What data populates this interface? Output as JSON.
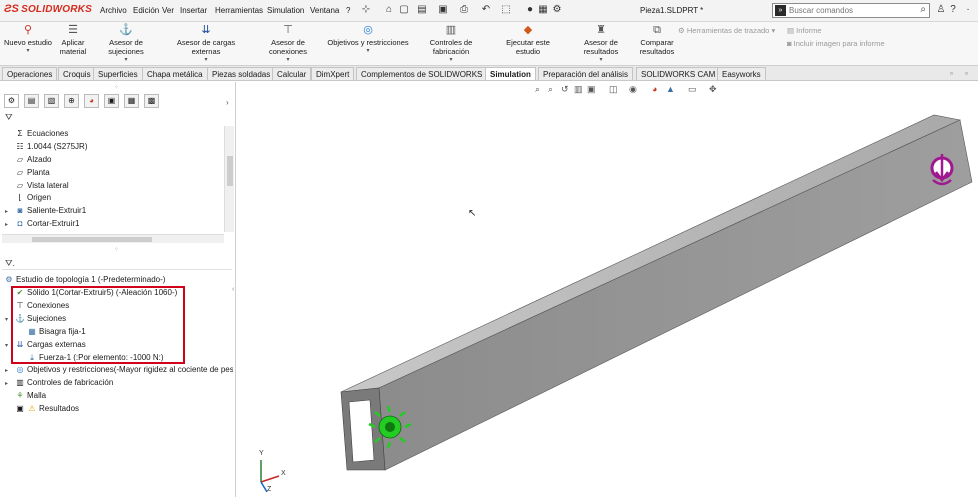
{
  "app": {
    "logo": "SOLIDWORKS",
    "document_title": "Pieza1.SLDPRT *"
  },
  "menu": [
    "Archivo",
    "Edición",
    "Ver",
    "Insertar",
    "Herramientas",
    "Simulation",
    "Ventana",
    "?"
  ],
  "search": {
    "placeholder": "Buscar comandos"
  },
  "ribbon": {
    "buttons": [
      {
        "label": "Nuevo estudio",
        "icon": "new-study-icon"
      },
      {
        "label": "Aplicar material",
        "icon": "apply-material-icon"
      },
      {
        "label": "Asesor de sujeciones",
        "icon": "fixture-advisor-icon"
      },
      {
        "label": "Asesor de cargas externas",
        "icon": "external-loads-icon"
      },
      {
        "label": "Asesor de conexiones",
        "icon": "connections-icon"
      },
      {
        "label": "Objetivos y restricciones",
        "icon": "goals-icon"
      },
      {
        "label": "Controles de fabricación",
        "icon": "manufacturing-icon"
      },
      {
        "label": "Ejecutar este estudio",
        "icon": "run-study-icon"
      },
      {
        "label": "Asesor de resultados",
        "icon": "results-advisor-icon"
      },
      {
        "label": "Comparar resultados",
        "icon": "compare-results-icon"
      },
      {
        "label": "Herramientas de trazado",
        "icon": "plot-tools-icon"
      }
    ],
    "report": "Informe",
    "include_image": "Incluir imagen para informe"
  },
  "tabs": [
    {
      "label": "Operaciones",
      "active": false
    },
    {
      "label": "Croquis",
      "active": false
    },
    {
      "label": "Superficies",
      "active": false
    },
    {
      "label": "Chapa metálica",
      "active": false
    },
    {
      "label": "Piezas soldadas",
      "active": false
    },
    {
      "label": "Calcular",
      "active": false
    },
    {
      "label": "DimXpert",
      "active": false
    },
    {
      "label": "Complementos de SOLIDWORKS",
      "active": false
    },
    {
      "label": "Simulation",
      "active": true
    },
    {
      "label": "Preparación del análisis",
      "active": false
    },
    {
      "label": "SOLIDWORKS CAM",
      "active": false
    },
    {
      "label": "Easyworks",
      "active": false
    }
  ],
  "feature_tree": [
    {
      "label": "Ecuaciones",
      "icon": "equations-icon"
    },
    {
      "label": "1.0044 (S275JR)",
      "icon": "material-icon"
    },
    {
      "label": "Alzado",
      "icon": "plane-icon"
    },
    {
      "label": "Planta",
      "icon": "plane-icon"
    },
    {
      "label": "Vista lateral",
      "icon": "plane-icon"
    },
    {
      "label": "Origen",
      "icon": "origin-icon"
    },
    {
      "label": "Saliente-Extruir1",
      "icon": "extrude-icon"
    },
    {
      "label": "Cortar-Extruir1",
      "icon": "cut-extrude-icon"
    }
  ],
  "study_tree": {
    "study": "Estudio de topología 1 (-Predeterminado-)",
    "items": [
      {
        "label": "Sólido 1(Cortar-Extruir5) (-Aleación 1060-)",
        "icon": "solid-body-icon"
      },
      {
        "label": "Conexiones",
        "icon": "connections-icon"
      },
      {
        "label": "Sujeciones",
        "icon": "fixtures-icon"
      },
      {
        "label": "Bisagra fija-1",
        "icon": "fixed-hinge-icon"
      },
      {
        "label": "Cargas externas",
        "icon": "external-loads-icon"
      },
      {
        "label": "Fuerza-1 (:Por elemento: -1000 N:)",
        "icon": "force-icon"
      },
      {
        "label": "Objetivos y restricciones(-Mayor rigidez al cociente de peso-)",
        "icon": "goals-icon"
      },
      {
        "label": "Controles de fabricación",
        "icon": "manufacturing-icon"
      },
      {
        "label": "Malla",
        "icon": "mesh-icon"
      },
      {
        "label": "Resultados",
        "icon": "results-icon"
      }
    ]
  },
  "triad": {
    "x": "X",
    "y": "Y",
    "z": "Z"
  },
  "colors": {
    "accent": "#d52b1e",
    "highlight_box": "#d0021b",
    "fixture": "#22cc22",
    "load": "#a01890"
  }
}
